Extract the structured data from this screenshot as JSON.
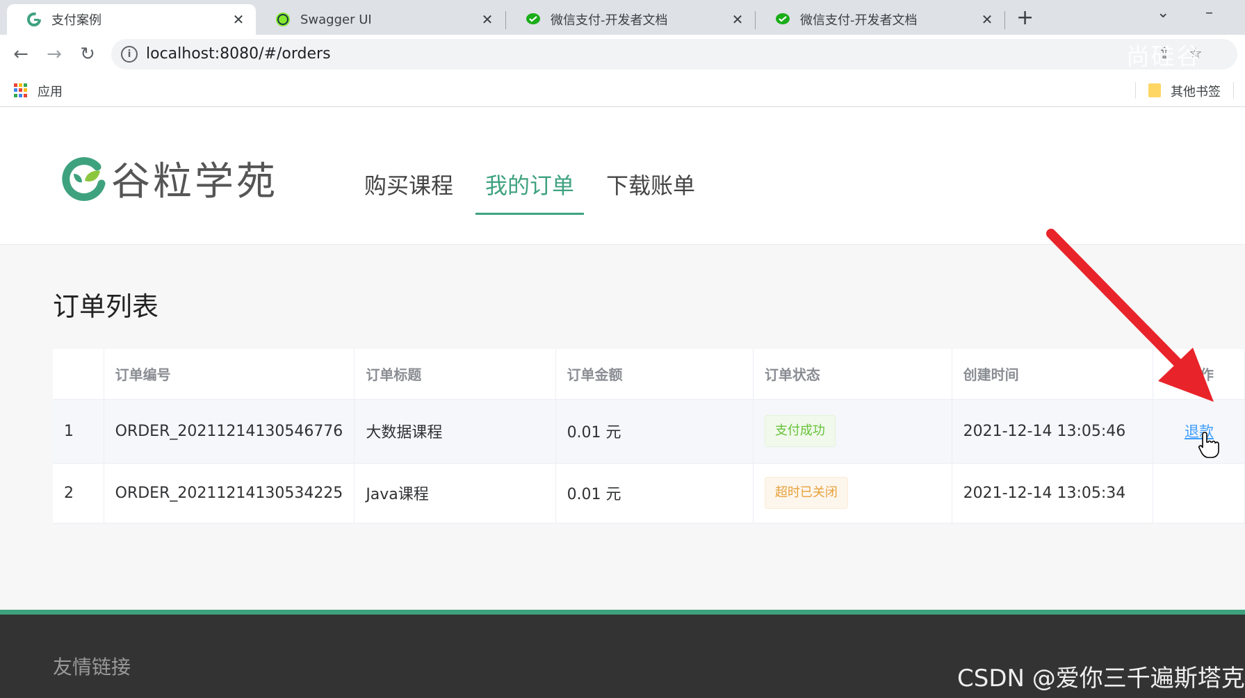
{
  "browser": {
    "tabs": [
      {
        "title": "支付案例",
        "icon": "g-logo-icon",
        "active": true
      },
      {
        "title": "Swagger UI",
        "icon": "swagger-icon",
        "active": false
      },
      {
        "title": "微信支付-开发者文档",
        "icon": "wechat-pay-icon",
        "active": false
      },
      {
        "title": "微信支付-开发者文档",
        "icon": "wechat-pay-icon",
        "active": false
      }
    ],
    "close_glyph": "✕",
    "new_tab_glyph": "+",
    "url": "localhost:8080/#/orders",
    "bookmarks": {
      "apps_label": "应用",
      "other_label": "其他书签"
    }
  },
  "site": {
    "logo_text": "谷粒学苑",
    "nav": [
      {
        "label": "购买课程",
        "active": false
      },
      {
        "label": "我的订单",
        "active": true
      },
      {
        "label": "下载账单",
        "active": false
      }
    ],
    "brand_color": "#3fa27f"
  },
  "orders": {
    "title": "订单列表",
    "columns": {
      "index": "",
      "order_no": "订单编号",
      "order_title": "订单标题",
      "amount": "订单金额",
      "status": "订单状态",
      "created": "创建时间",
      "action": "操作"
    },
    "rows": [
      {
        "index": "1",
        "order_no": "ORDER_20211214130546776",
        "order_title": "大数据课程",
        "amount": "0.01 元",
        "status": "支付成功",
        "status_type": "success",
        "created": "2021-12-14 13:05:46",
        "action": "退款"
      },
      {
        "index": "2",
        "order_no": "ORDER_20211214130534225",
        "order_title": "Java课程",
        "amount": "0.01 元",
        "status": "超时已关闭",
        "status_type": "warning",
        "created": "2021-12-14 13:05:34",
        "action": ""
      }
    ]
  },
  "footer": {
    "title": "友情链接"
  },
  "watermarks": {
    "csdn": "CSDN @爱你三千遍斯塔克",
    "top": "尚硅谷"
  },
  "annotation": {
    "arrow_color": "#e8242a"
  }
}
